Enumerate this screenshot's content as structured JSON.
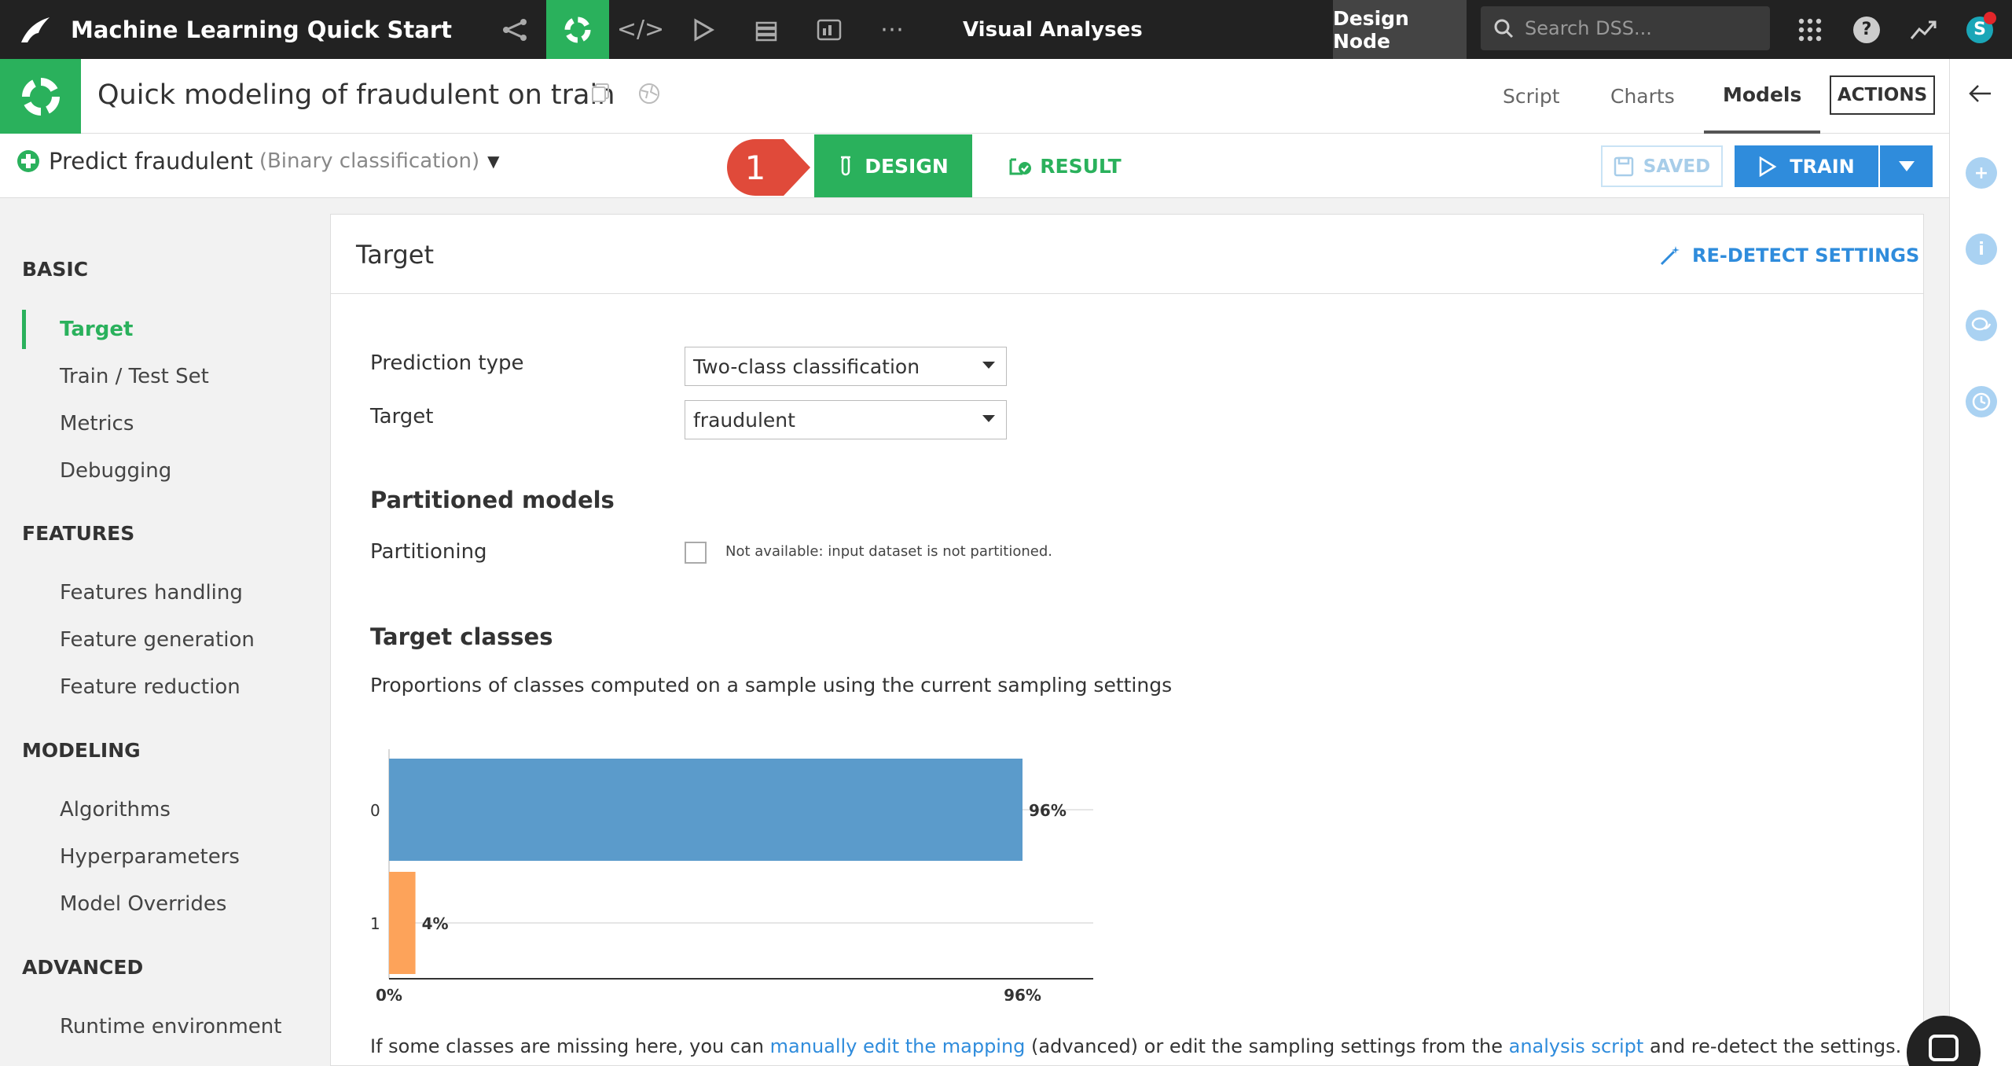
{
  "app": {
    "project_name": "Machine Learning Quick Start",
    "section": "Visual Analyses",
    "node_label": "Design Node",
    "search_placeholder": "Search DSS...",
    "avatar_initial": "S",
    "help_glyph": "?",
    "accent_green": "#2ab15c",
    "accent_blue": "#2f8cdc"
  },
  "header": {
    "title": "Quick modeling of fraudulent on train",
    "tabs": [
      {
        "label": "Script"
      },
      {
        "label": "Charts"
      },
      {
        "label": "Models",
        "active": true
      }
    ],
    "actions_label": "ACTIONS"
  },
  "subheader": {
    "task_name": "Predict fraudulent",
    "task_kind": "(Binary classification)",
    "callout_number": "1",
    "design_label": "DESIGN",
    "result_label": "RESULT",
    "saved_label": "SAVED",
    "train_label": "TRAIN"
  },
  "sidebar": {
    "sections": [
      {
        "title": "BASIC",
        "items": [
          "Target",
          "Train / Test Set",
          "Metrics",
          "Debugging"
        ]
      },
      {
        "title": "FEATURES",
        "items": [
          "Features handling",
          "Feature generation",
          "Feature reduction"
        ]
      },
      {
        "title": "MODELING",
        "items": [
          "Algorithms",
          "Hyperparameters",
          "Model Overrides"
        ]
      },
      {
        "title": "ADVANCED",
        "items": [
          "Runtime environment"
        ]
      }
    ],
    "active_item": "Target"
  },
  "panel": {
    "title": "Target",
    "redetect_label": "RE-DETECT SETTINGS",
    "prediction_type_label": "Prediction type",
    "prediction_type_value": "Two-class classification",
    "target_label": "Target",
    "target_value": "fraudulent",
    "partitioned_title": "Partitioned models",
    "partitioning_label": "Partitioning",
    "partitioning_note": "Not available: input dataset is not partitioned.",
    "target_classes_title": "Target classes",
    "target_classes_desc": "Proportions of classes computed on a sample using the current sampling settings",
    "bottom_text_1": "If some classes are missing here, you can ",
    "bottom_link_1": "manually edit the mapping",
    "bottom_text_2": " (advanced) or edit the sampling settings from the ",
    "bottom_link_2": "analysis script",
    "bottom_text_3": " and re-detect the settings."
  },
  "chart_data": {
    "type": "bar",
    "orientation": "horizontal",
    "categories": [
      "0",
      "1"
    ],
    "values": [
      96,
      4
    ],
    "value_labels": [
      "96%",
      "4%"
    ],
    "colors": [
      "#5b9bcb",
      "#fda35a"
    ],
    "x_tick_labels": [
      "0%",
      "96%"
    ],
    "xlim": [
      0,
      96
    ],
    "grid": true
  }
}
